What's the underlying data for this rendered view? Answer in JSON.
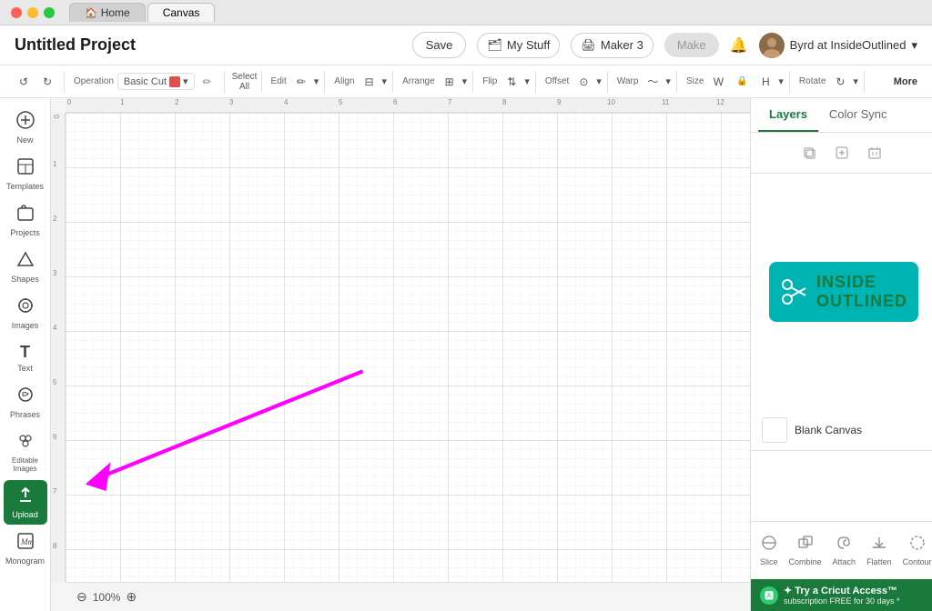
{
  "titlebar": {
    "tabs": [
      {
        "id": "home",
        "label": "Home",
        "active": false
      },
      {
        "id": "canvas",
        "label": "Canvas",
        "active": true
      }
    ]
  },
  "navbar": {
    "project_title": "Untitled Project",
    "save_label": "Save",
    "mystuff_label": "My Stuff",
    "maker3_label": "Maker 3",
    "make_label": "Make",
    "user_label": "Byrd at InsideOutlined"
  },
  "toolbar": {
    "operation_label": "Operation",
    "operation_value": "Basic Cut",
    "select_all_label": "Select All",
    "edit_label": "Edit",
    "align_label": "Align",
    "arrange_label": "Arrange",
    "flip_label": "Flip",
    "offset_label": "Offset",
    "warp_label": "Warp",
    "size_label": "Size",
    "rotate_label": "Rotate",
    "more_label": "More"
  },
  "sidebar": {
    "items": [
      {
        "id": "new",
        "label": "New",
        "icon": "+"
      },
      {
        "id": "templates",
        "label": "Templates",
        "icon": "⊞"
      },
      {
        "id": "projects",
        "label": "Projects",
        "icon": "☁"
      },
      {
        "id": "shapes",
        "label": "Shapes",
        "icon": "△"
      },
      {
        "id": "images",
        "label": "Images",
        "icon": "💡"
      },
      {
        "id": "text",
        "label": "Text",
        "icon": "T"
      },
      {
        "id": "phrases",
        "label": "Phrases",
        "icon": "💬"
      },
      {
        "id": "editable-images",
        "label": "Editable Images",
        "icon": "✦"
      },
      {
        "id": "upload",
        "label": "Upload",
        "icon": "↑",
        "active": true
      },
      {
        "id": "monogram",
        "label": "Monogram",
        "icon": "⊞"
      }
    ]
  },
  "right_panel": {
    "tabs": [
      {
        "id": "layers",
        "label": "Layers",
        "active": true
      },
      {
        "id": "color-sync",
        "label": "Color Sync",
        "active": false
      }
    ],
    "layer_item": {
      "name": "Blank Canvas"
    },
    "bottom_actions": [
      {
        "id": "slice",
        "label": "Slice"
      },
      {
        "id": "combine",
        "label": "Combine"
      },
      {
        "id": "attach",
        "label": "Attach"
      },
      {
        "id": "flatten",
        "label": "Flatten"
      },
      {
        "id": "contour",
        "label": "Contour"
      }
    ]
  },
  "logo": {
    "inside_text": "INSIDE",
    "outlined_text": "OUTLINED"
  },
  "bottom_bar": {
    "zoom_level": "100%"
  },
  "cricut_access": {
    "text": "✦ Try a Cricut Access™",
    "subtext": "subscription FREE for 30 days *"
  },
  "ruler": {
    "numbers": [
      "0",
      "1",
      "2",
      "3",
      "4",
      "5",
      "6",
      "7",
      "8",
      "9",
      "10",
      "11",
      "12"
    ]
  }
}
